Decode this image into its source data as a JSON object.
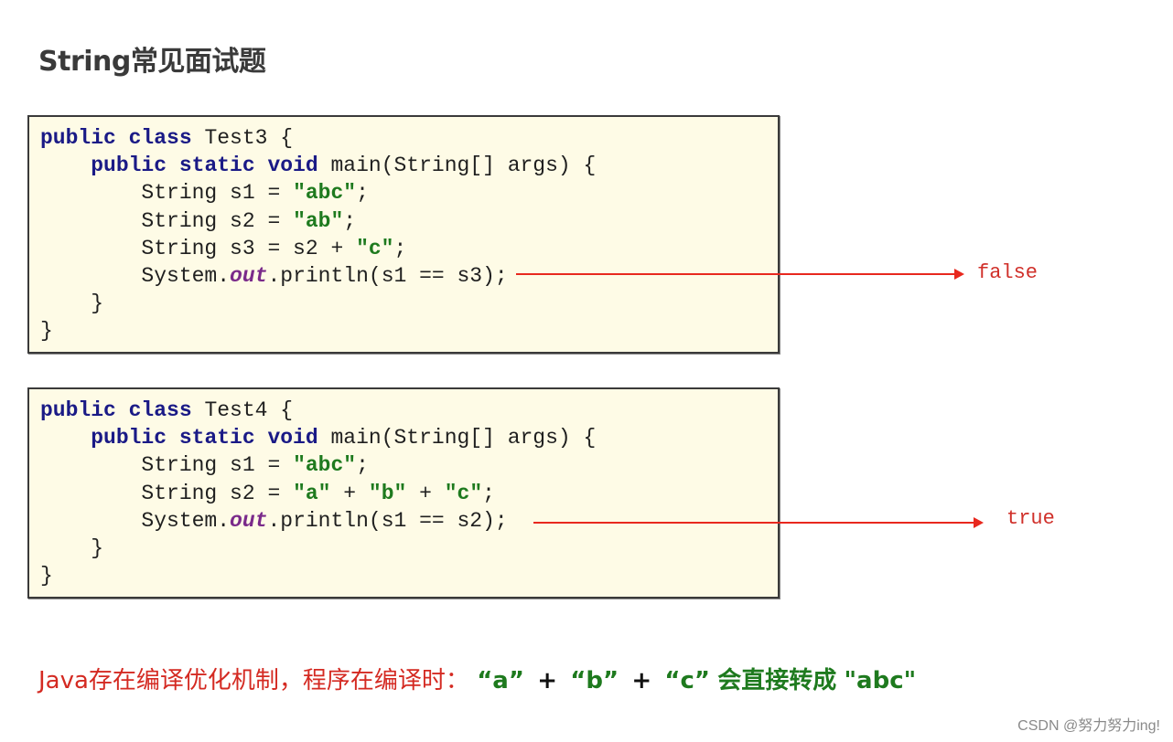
{
  "title": "String常见面试题",
  "examples": [
    {
      "class_name": "Test3",
      "lines": {
        "l1_kw": "public class ",
        "l1_rest": "Test3 {",
        "l2_kw": "public static void ",
        "l2_rest": "main(String[] args) {",
        "l3_pre": "String s1 = ",
        "l3_str": "\"abc\"",
        "l3_post": ";",
        "l4_pre": "String s2 = ",
        "l4_str": "\"ab\"",
        "l4_post": ";",
        "l5_pre": "String s3 = s2 + ",
        "l5_str": "\"c\"",
        "l5_post": ";",
        "l6_pre": "System.",
        "l6_field": "out",
        "l6_post": ".println(s1 == s3);",
        "l7": "}",
        "l8": "}"
      },
      "result": "false"
    },
    {
      "class_name": "Test4",
      "lines": {
        "l1_kw": "public class ",
        "l1_rest": "Test4 {",
        "l2_kw": "public static void ",
        "l2_rest": "main(String[] args) {",
        "l3_pre": "String s1 = ",
        "l3_str": "\"abc\"",
        "l3_post": ";",
        "l4_pre": "String s2 = ",
        "l4_str1": "\"a\"",
        "l4_plus1": " + ",
        "l4_str2": "\"b\"",
        "l4_plus2": " + ",
        "l4_str3": "\"c\"",
        "l4_post": ";",
        "l5_pre": "System.",
        "l5_field": "out",
        "l5_post": ".println(s1 == s2);",
        "l6": "}",
        "l7": "}"
      },
      "result": "true"
    }
  ],
  "note": {
    "prefix": "Java存在编译优化机制，程序在编译时：",
    "a": "“a”",
    "plus": "+",
    "b": "“b”",
    "c": "“c”",
    "suffix": "会直接转成",
    "result": "\"abc\""
  },
  "watermark": "CSDN @努力努力ing!",
  "colors": {
    "keyword": "#1a1a86",
    "string": "#1e7a1e",
    "field": "#7a2a8a",
    "arrow": "#e8281e",
    "box_bg": "#fefbe6"
  }
}
